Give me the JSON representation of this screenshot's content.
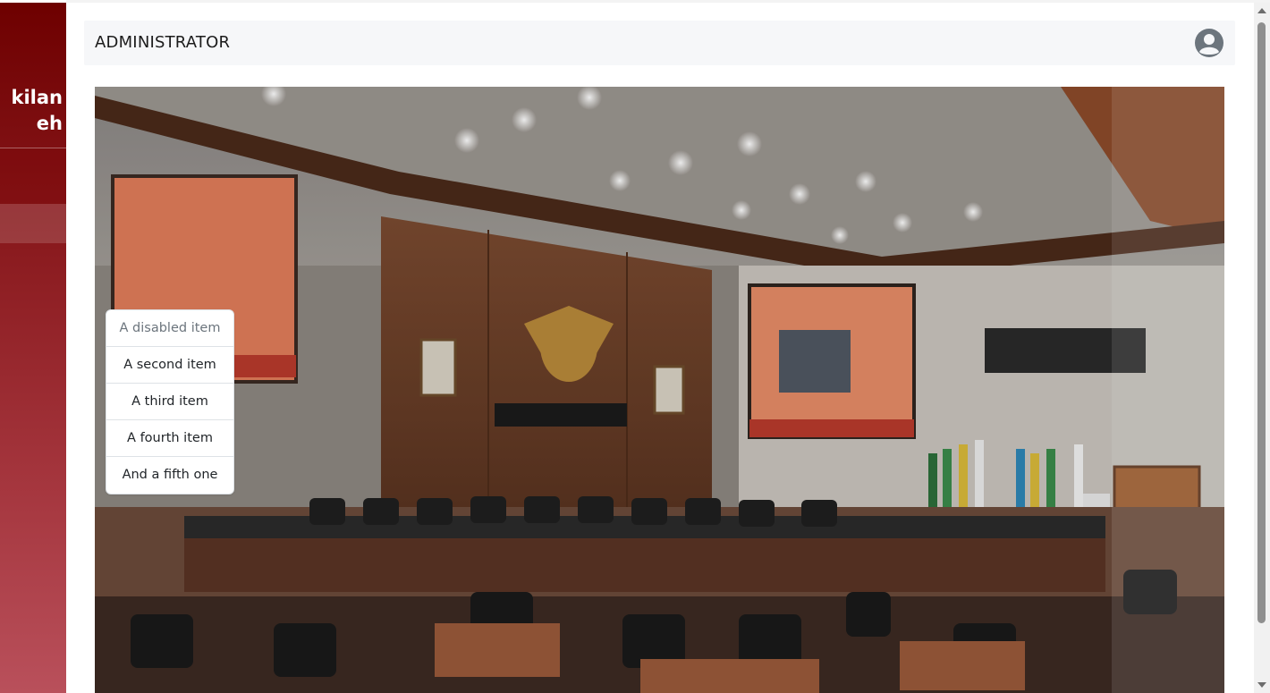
{
  "sidebar": {
    "brand_line1": "kilan",
    "brand_line2": "eh"
  },
  "header": {
    "title": "ADMINISTRATOR",
    "user_icon": "user-circle-icon"
  },
  "main": {
    "photo_subject": "parliament-chamber-photo"
  },
  "list_group": {
    "items": [
      {
        "label": "A disabled item",
        "disabled": true
      },
      {
        "label": "A second item",
        "disabled": false
      },
      {
        "label": "A third item",
        "disabled": false
      },
      {
        "label": "A fourth item",
        "disabled": false
      },
      {
        "label": "And a fifth one",
        "disabled": false
      }
    ]
  },
  "colors": {
    "sidebar_top": "#6e0000",
    "sidebar_bottom": "#b9505b",
    "header_bg": "#f6f7f9"
  }
}
